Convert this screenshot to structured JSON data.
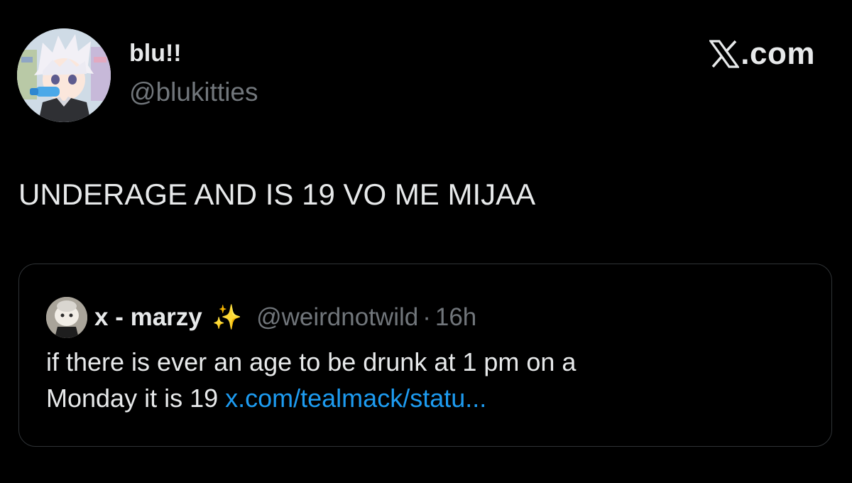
{
  "author": {
    "display_name": "blu!!",
    "handle": "@blukitties"
  },
  "brand": {
    "text": ".com",
    "icon": "x-logo-icon"
  },
  "tweet": {
    "text": "UNDERAGE AND IS 19 VO ME MIJAA"
  },
  "quoted_tweet": {
    "display_name": "x - marzy",
    "emoji": "✨",
    "handle": "@weirdnotwild",
    "separator": "·",
    "time": "16h",
    "text_line1": "if there is ever an age to be drunk at 1 pm on a",
    "text_line2": "Monday it is 19 ",
    "link": "x.com/tealmack/statu..."
  },
  "colors": {
    "background": "#000000",
    "primary_text": "#e7e9ea",
    "secondary_text": "#71767b",
    "link": "#1d9bf0",
    "border": "#2f3336"
  }
}
